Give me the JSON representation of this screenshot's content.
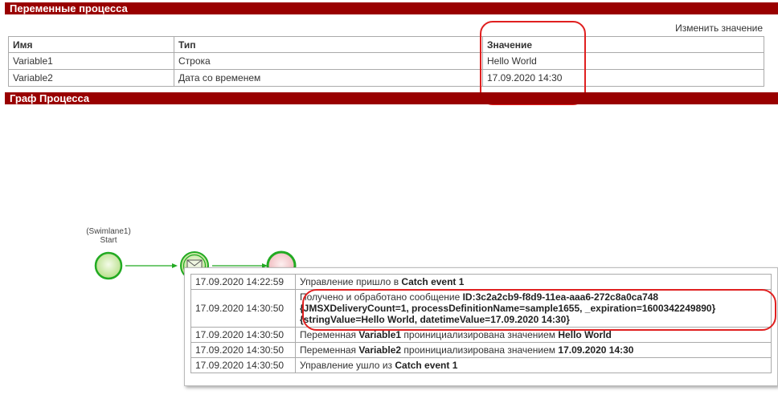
{
  "variables_section": {
    "title": "Переменные процесса",
    "edit_link": "Изменить значение",
    "columns": [
      "Имя",
      "Тип",
      "Значение"
    ],
    "rows": [
      [
        "Variable1",
        "Строка",
        "Hello World"
      ],
      [
        "Variable2",
        "Дата со временем",
        "17.09.2020 14:30"
      ]
    ]
  },
  "graph_section": {
    "title": "Граф Процесса",
    "swimlane_label": "(Swimlane1)",
    "start_label": "Start"
  },
  "log": {
    "rows": [
      {
        "ts": "17.09.2020 14:22:59",
        "prefix": "Управление пришло в ",
        "bold": "Catch event 1",
        "suffix": ""
      },
      {
        "ts": "17.09.2020 14:30:50",
        "prefix": "Получено и обработано сообщение ",
        "bold": "ID:3c2a2cb9-f8d9-11ea-aaa6-272c8a0ca748",
        "line2": "{JMSXDeliveryCount=1, processDefinitionName=sample1655, _expiration=1600342249890}",
        "line3": "{stringValue=Hello World, datetimeValue=17.09.2020 14:30}"
      },
      {
        "ts": "17.09.2020 14:30:50",
        "prefix": "Переменная ",
        "bold": "Variable1",
        "mid": " проинициализирована значением ",
        "bold2": "Hello World"
      },
      {
        "ts": "17.09.2020 14:30:50",
        "prefix": "Переменная ",
        "bold": "Variable2",
        "mid": " проинициализирована значением ",
        "bold2": "17.09.2020 14:30"
      },
      {
        "ts": "17.09.2020 14:30:50",
        "prefix": "Управление ушло из ",
        "bold": "Catch event 1",
        "suffix": ""
      }
    ]
  },
  "colors": {
    "header_bar": "#990000",
    "highlight": "#e02020",
    "node_green": "#22aa22",
    "node_red": "#cc2222"
  }
}
